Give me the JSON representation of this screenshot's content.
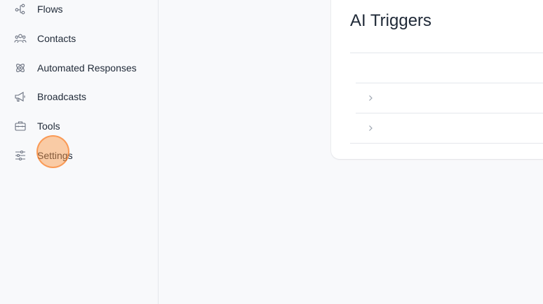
{
  "sidebar": {
    "items": [
      {
        "label": "Flows",
        "icon": "flows-icon"
      },
      {
        "label": "Contacts",
        "icon": "contacts-icon"
      },
      {
        "label": "Automated Responses",
        "icon": "automated-responses-icon"
      },
      {
        "label": "Broadcasts",
        "icon": "megaphone-icon"
      },
      {
        "label": "Tools",
        "icon": "toolbox-icon"
      },
      {
        "label": "Settings",
        "icon": "sliders-icon"
      }
    ]
  },
  "main": {
    "card": {
      "title": "AI Triggers",
      "rows": [
        {
          "icon": "chevron-right-icon"
        },
        {
          "icon": "chevron-right-icon"
        }
      ]
    }
  },
  "colors": {
    "page_background": "#f8f9fb",
    "card_background": "#ffffff",
    "divider": "#e4e7ec",
    "click_marker": "#fb923c"
  }
}
